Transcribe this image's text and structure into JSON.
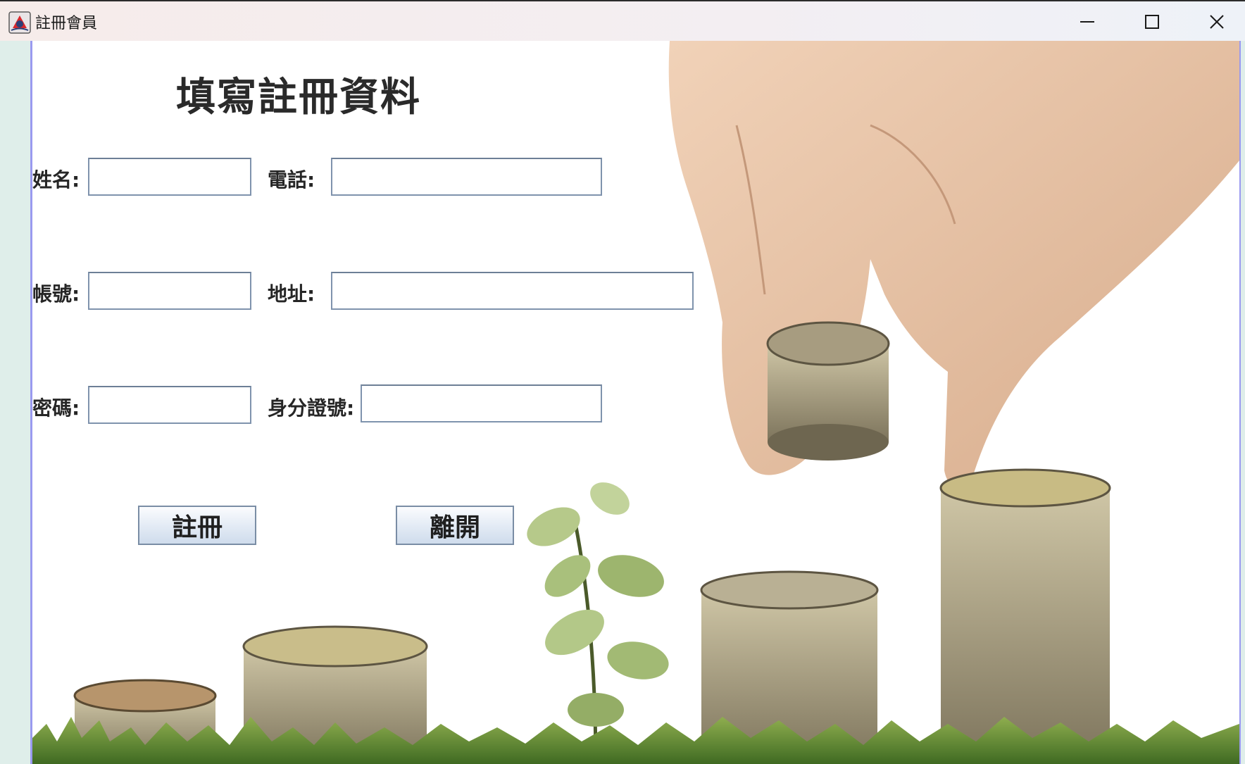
{
  "window": {
    "title": "註冊會員",
    "icon": "java-app-icon",
    "controls": [
      "minimize-icon",
      "maximize-icon",
      "close-icon"
    ]
  },
  "form": {
    "heading": "填寫註冊資料",
    "name_label": "姓名:",
    "name_value": "",
    "phone_label": "電話:",
    "phone_value": "",
    "account_label": "帳號:",
    "account_value": "",
    "address_label": "地址:",
    "address_value": "",
    "password_label": "密碼:",
    "password_value": "",
    "id_label": "身分證號:",
    "id_value": ""
  },
  "buttons": {
    "register": "註冊",
    "exit": "離開"
  },
  "colors": {
    "frame_accent": "#9a9af0",
    "side_strip": "#dfeeea",
    "button_border": "#7a8da5",
    "text": "#262626"
  }
}
